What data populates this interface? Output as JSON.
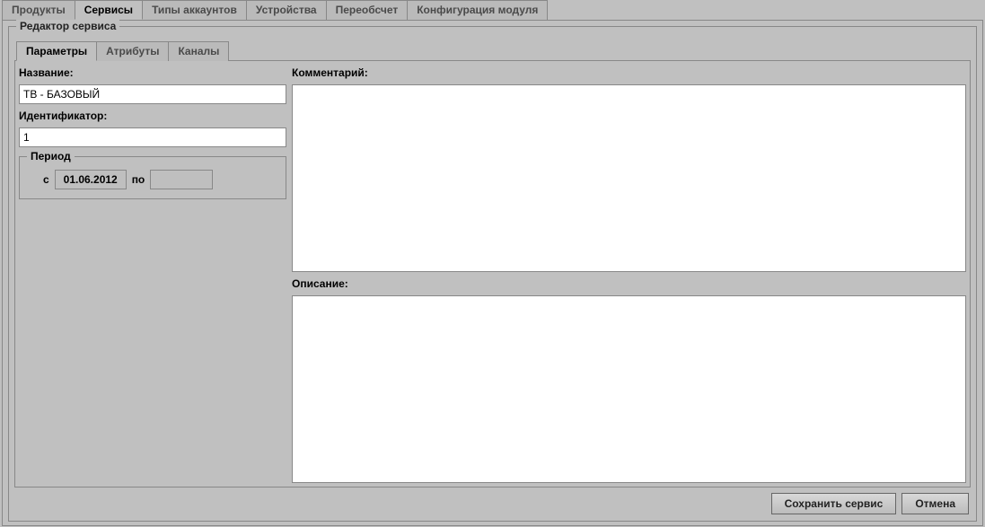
{
  "outerTabs": {
    "products": "Продукты",
    "services": "Сервисы",
    "accountTypes": "Типы аккаунтов",
    "devices": "Устройства",
    "recalc": "Переобсчет",
    "moduleConfig": "Конфигурация модуля"
  },
  "editor": {
    "title": "Редактор сервиса"
  },
  "innerTabs": {
    "params": "Параметры",
    "attrs": "Атрибуты",
    "channels": "Каналы"
  },
  "fields": {
    "nameLabel": "Название:",
    "nameValue": "ТВ - БАЗОВЫЙ",
    "idLabel": "Идентификатор:",
    "idValue": "1",
    "periodTitle": "Период",
    "periodFrom": "с",
    "periodFromValue": "01.06.2012",
    "periodTo": "по",
    "periodToValue": "",
    "commentLabel": "Комментарий:",
    "commentValue": "",
    "descLabel": "Описание:",
    "descValue": ""
  },
  "buttons": {
    "save": "Сохранить сервис",
    "cancel": "Отмена"
  }
}
